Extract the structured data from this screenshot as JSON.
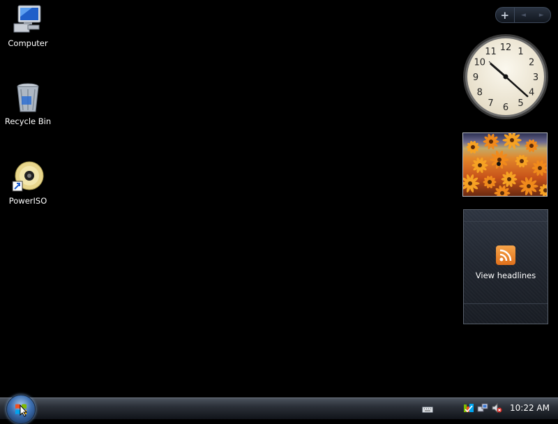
{
  "desktop": {
    "icons": [
      {
        "label": "Computer",
        "icon": "computer-icon"
      },
      {
        "label": "Recycle Bin",
        "icon": "recycle-bin-icon"
      },
      {
        "label": "PowerISO",
        "icon": "poweriso-disc-icon"
      }
    ]
  },
  "sidebar": {
    "controls": {
      "add": "+",
      "prev": "◄",
      "next": "►"
    },
    "clock": {
      "time": "10:22"
    },
    "slideshow": {
      "icon": "slideshow-photo"
    },
    "feed": {
      "label": "View headlines",
      "icon": "rss-feed-icon"
    }
  },
  "taskbar": {
    "time": "10:22 AM",
    "tray_icons": [
      "keyboard-icon",
      "security-center-icon",
      "network-icon",
      "volume-muted-icon"
    ]
  },
  "colors": {
    "desktop_bg": "#000000",
    "rss_orange": "#f08a24",
    "orb_blue": "#3d6fb0"
  }
}
